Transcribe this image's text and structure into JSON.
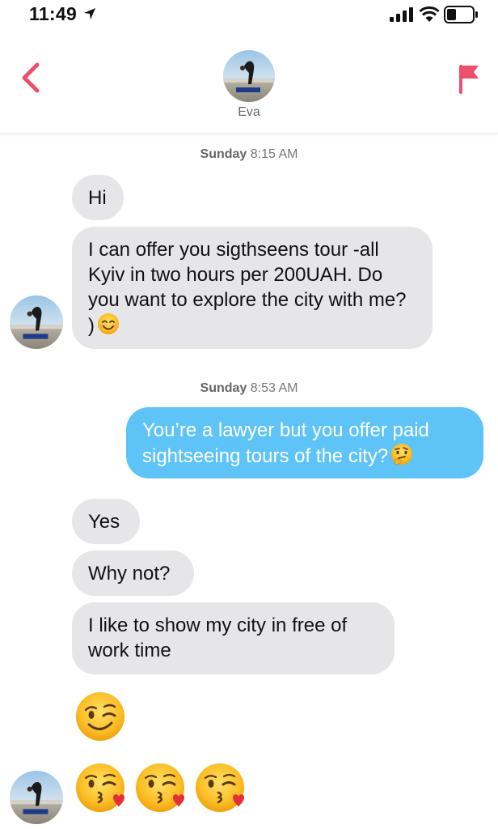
{
  "status_bar": {
    "time": "11:49"
  },
  "header": {
    "contact_name": "Eva"
  },
  "timestamps": [
    {
      "day": "Sunday",
      "time": "8:15 AM"
    },
    {
      "day": "Sunday",
      "time": "8:53 AM"
    }
  ],
  "messages": [
    {
      "from": "them",
      "text": "Hi"
    },
    {
      "from": "them",
      "text": "I can offer you sigthseens tour -all Kyiv in two hours per 200UAH. Do you want to explore the city with me? )",
      "emoji": "smiling-face"
    },
    {
      "from": "me",
      "text": "You’re a lawyer but you offer paid sightseeing tours of the city?",
      "emoji": "thinking-face"
    },
    {
      "from": "them",
      "text": "Yes"
    },
    {
      "from": "them",
      "text": "Why not?"
    },
    {
      "from": "them",
      "text": "I like to show my city in free of work time"
    },
    {
      "from": "them",
      "emoji": "winking-face"
    },
    {
      "from": "them",
      "emoji": [
        "kissing-heart-face",
        "kissing-heart-face",
        "kissing-heart-face"
      ]
    }
  ],
  "colors": {
    "accent": "#ee4f6b",
    "outgoing_bubble": "#5ec3f7",
    "incoming_bubble": "#e6e6e8"
  }
}
